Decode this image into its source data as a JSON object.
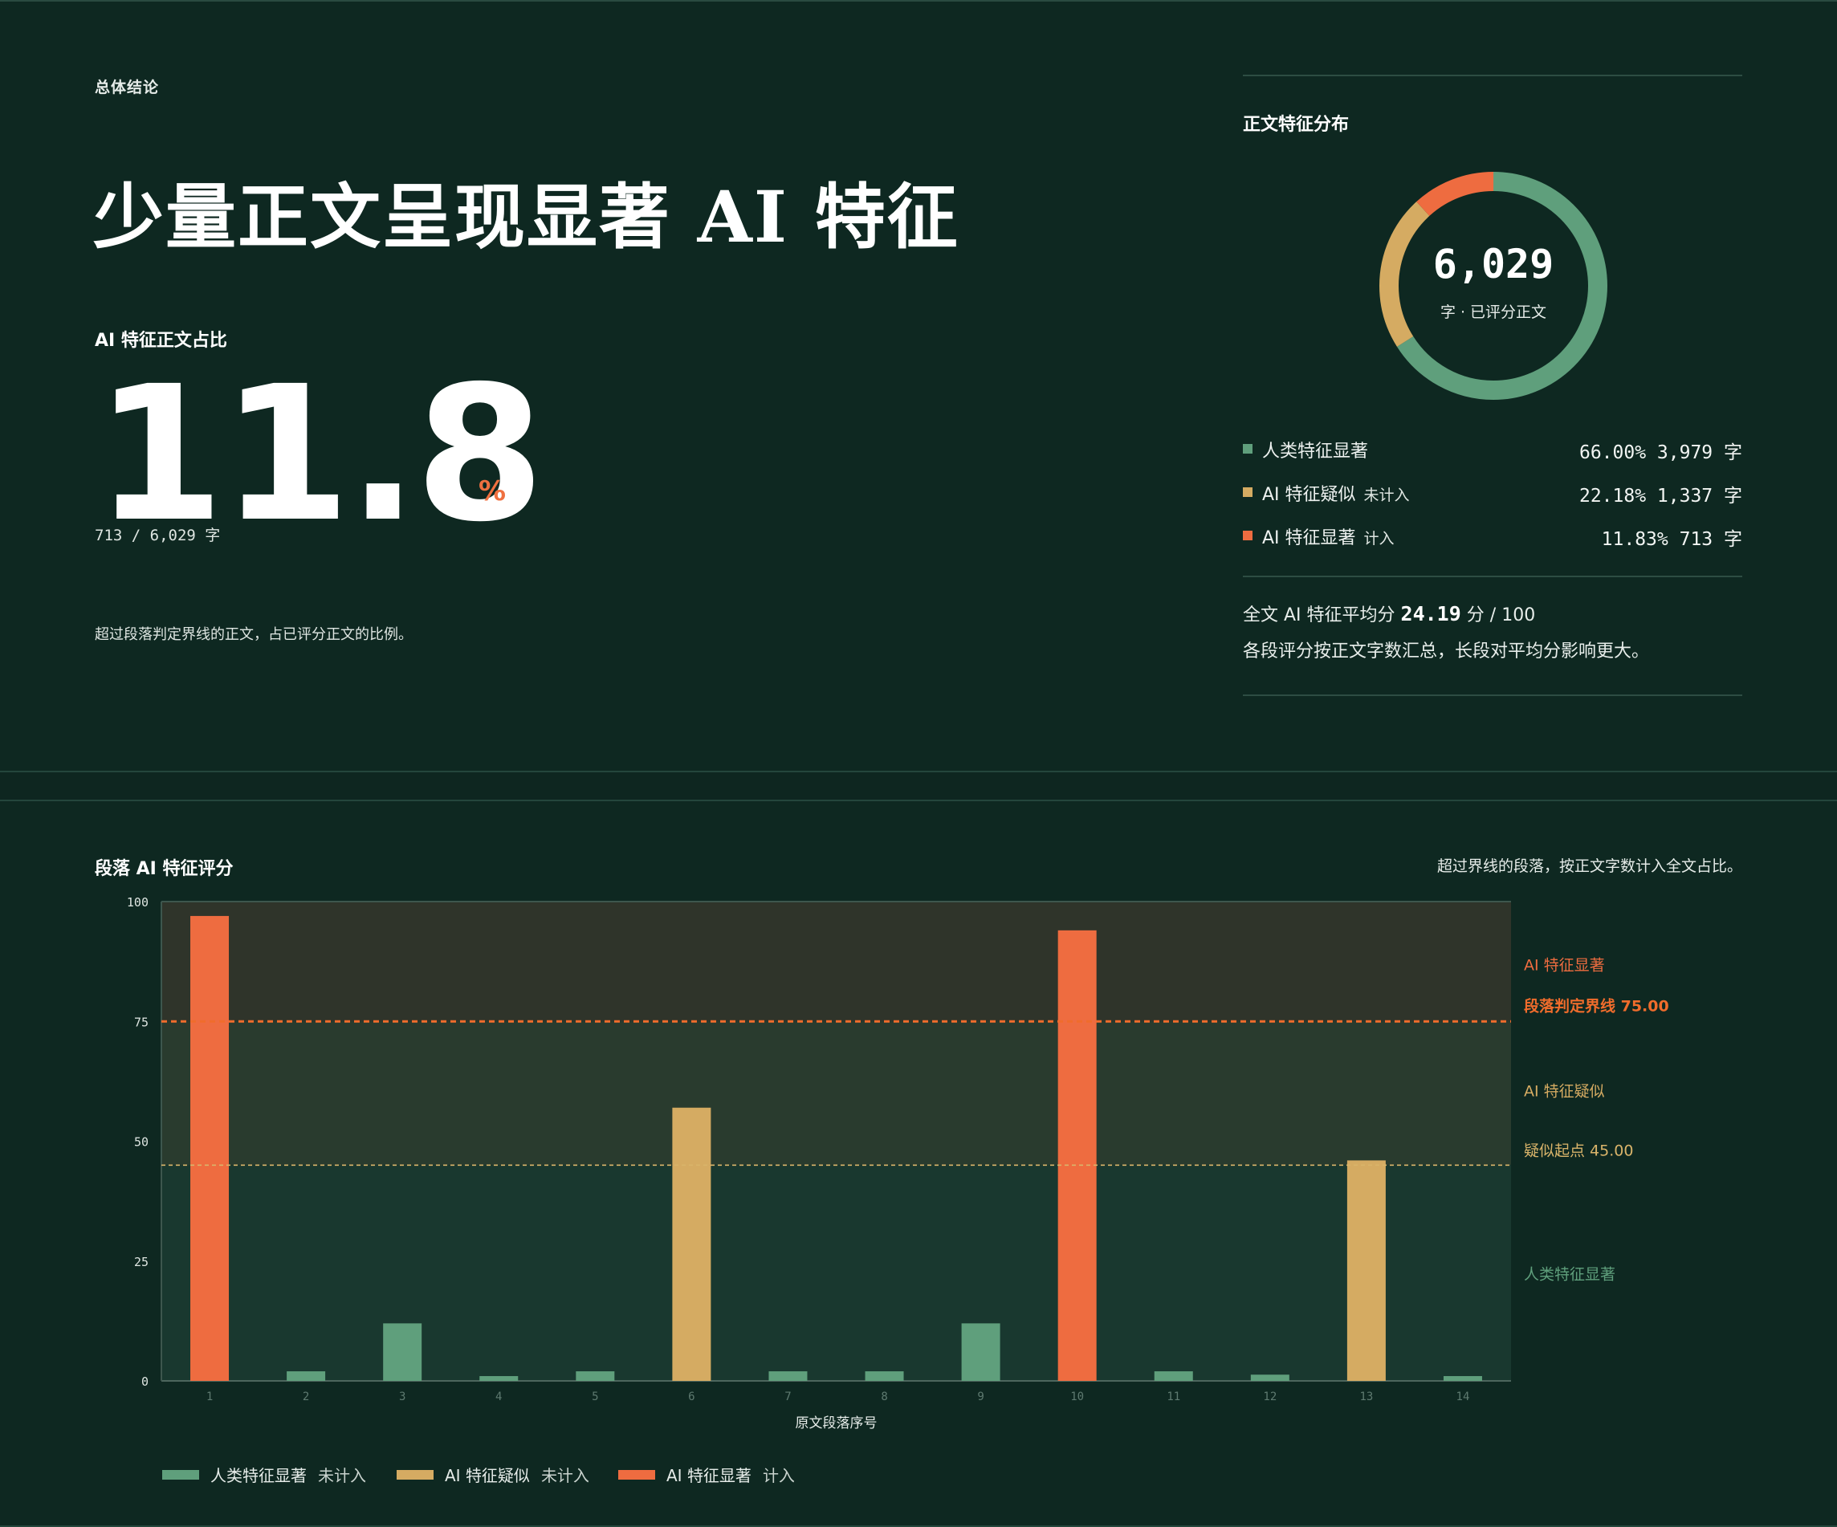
{
  "summary": {
    "eyebrow": "总体结论",
    "headline": "少量正文呈现显著 AI 特征",
    "metric_label": "AI 特征正文占比",
    "metric_value": "11.8",
    "metric_unit": "%",
    "metric_detail": "713 / 6,029 字",
    "footnote": "超过段落判定界线的正文，占已评分正文的比例。"
  },
  "distribution": {
    "title": "正文特征分布",
    "total": "6,029",
    "total_caption": "字 · 已评分正文",
    "donut_fractions": [
      0.66,
      0.2218,
      0.1183
    ],
    "colors": {
      "human": "#5f9f7c",
      "suspect": "#d5ab62",
      "ai": "#ee6c40"
    },
    "rows": [
      {
        "name": "人类特征显著",
        "note": "",
        "value": "66.00% 3,979 字"
      },
      {
        "name": "AI 特征疑似",
        "note": "未计入",
        "value": "22.18% 1,337 字"
      },
      {
        "name": "AI 特征显著",
        "note": "计入",
        "value": "11.83% 713 字"
      }
    ],
    "avg_prefix": "全文 AI 特征平均分",
    "avg_value": "24.19",
    "avg_suffix": "分 / 100",
    "avg_note": "各段评分按正文字数汇总，长段对平均分影响更大。"
  },
  "chart_header": {
    "title": "段落 AI 特征评分",
    "note": "超过界线的段落，按正文字数计入全文占比。"
  },
  "chart_data": {
    "type": "bar",
    "title": "段落 AI 特征评分",
    "xlabel": "原文段落序号",
    "ylabel": "",
    "categories": [
      "1",
      "2",
      "3",
      "4",
      "5",
      "6",
      "7",
      "8",
      "9",
      "10",
      "11",
      "12",
      "13",
      "14"
    ],
    "values": [
      97,
      2,
      12,
      1,
      2,
      57,
      2,
      2,
      12,
      94,
      2,
      1.3,
      46,
      1
    ],
    "ylim": [
      0,
      100
    ],
    "yticks": [
      "0",
      "25",
      "50",
      "75",
      "100"
    ],
    "thresholds": [
      {
        "label": "段落判定界线 75.00",
        "value": 75,
        "color": "#f06c2c"
      },
      {
        "label": "疑似起点 45.00",
        "value": 45,
        "color": "#d9b46a"
      }
    ],
    "zone_labels": [
      {
        "label": "AI 特征显著",
        "color": "#ee6c40"
      },
      {
        "label": "AI 特征疑似",
        "color": "#d5ab62"
      },
      {
        "label": "人类特征显著",
        "color": "#5f9f7c"
      }
    ],
    "legend": [
      {
        "name": "人类特征显著",
        "note": "未计入",
        "color": "#5f9f7c"
      },
      {
        "name": "AI 特征疑似",
        "note": "未计入",
        "color": "#d5ab62"
      },
      {
        "name": "AI 特征显著",
        "note": "计入",
        "color": "#ee6c40"
      }
    ],
    "grid": false,
    "legend_position": "bottom-left"
  }
}
